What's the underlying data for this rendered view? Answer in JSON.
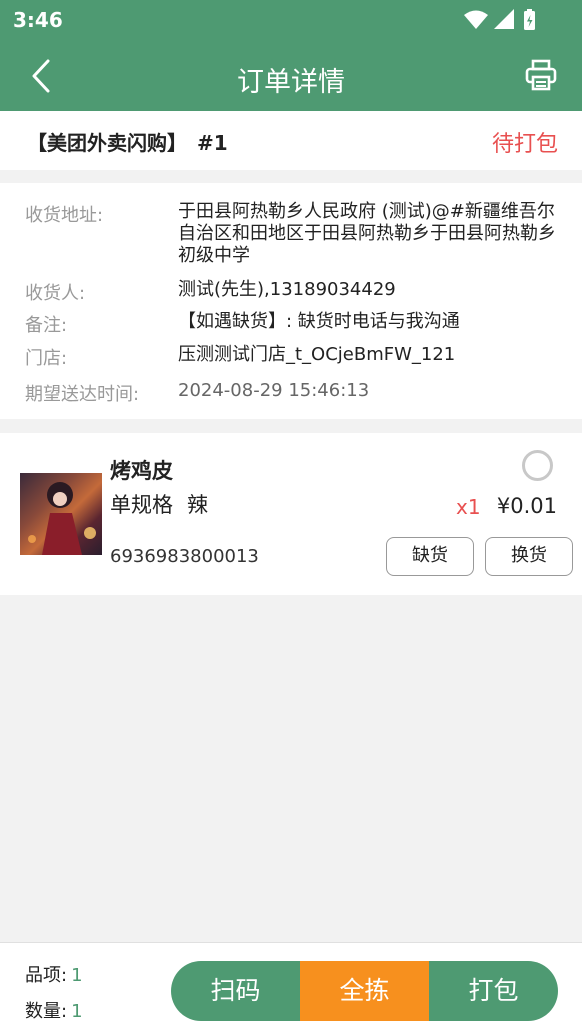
{
  "status_bar": {
    "time": "3:46"
  },
  "header": {
    "title": "订单详情"
  },
  "order": {
    "source": "【美团外卖闪购】",
    "number": "#1",
    "status": "待打包"
  },
  "info": {
    "address_label": "收货地址:",
    "address_value": "于田县阿热勒乡人民政府 (测试)@#新疆维吾尔自治区和田地区于田县阿热勒乡于田县阿热勒乡初级中学",
    "receiver_label": "收货人:",
    "receiver_value": "测试(先生),13189034429",
    "remark_label": "备注:",
    "remark_value": "【如遇缺货】: 缺货时电话与我沟通",
    "store_label": "门店:",
    "store_value": "压测测试门店_t_OCjeBmFW_121",
    "time_label": "期望送达时间:",
    "time_value": "2024-08-29 15:46:13"
  },
  "goods": {
    "name": "烤鸡皮",
    "spec": "单规格",
    "flavor": "辣",
    "code": "6936983800013",
    "qty": "x1",
    "price": "¥0.01",
    "btn_out": "缺货",
    "btn_swap": "换货"
  },
  "footer": {
    "items_label": "品项:",
    "items_value": "1",
    "qty_label": "数量:",
    "qty_value": "1",
    "scan_label": "扫码",
    "pick_all_label": "全拣",
    "pack_label": "打包"
  },
  "colors": {
    "primary": "#4e9a72",
    "accent": "#f7901e",
    "alert": "#e85050"
  },
  "icons": [
    "back-arrow-icon",
    "printer-icon",
    "wifi-icon",
    "signal-icon",
    "battery-icon",
    "check-circle-icon"
  ]
}
